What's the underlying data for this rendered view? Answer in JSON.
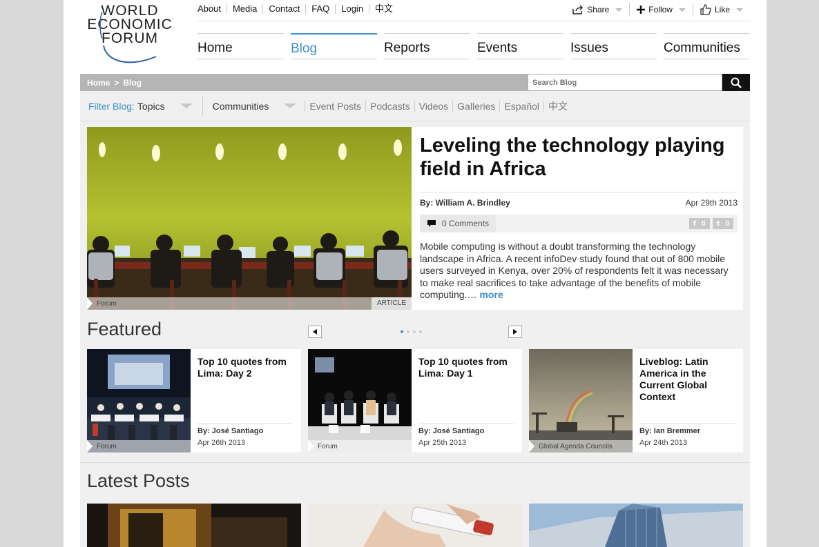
{
  "logo": {
    "lines": [
      "WORLD",
      "ECONOMIC",
      "FORUM"
    ]
  },
  "topnav": [
    "About",
    "Media",
    "Contact",
    "FAQ",
    "Login",
    "中文"
  ],
  "social": {
    "share": "Share",
    "follow": "Follow",
    "like": "Like"
  },
  "mainnav": [
    {
      "label": "Home",
      "active": false
    },
    {
      "label": "Blog",
      "active": true
    },
    {
      "label": "Reports",
      "active": false
    },
    {
      "label": "Events",
      "active": false
    },
    {
      "label": "Issues",
      "active": false
    },
    {
      "label": "Communities",
      "active": false
    }
  ],
  "breadcrumb": {
    "home": "Home",
    "sep": ">",
    "current": "Blog"
  },
  "search": {
    "placeholder": "Search Blog"
  },
  "filter": {
    "label": "Filter Blog:",
    "topics": "Topics",
    "communities": "Communities",
    "links": [
      "Event Posts",
      "Podcasts",
      "Videos",
      "Galleries",
      "Español",
      "中文"
    ]
  },
  "hero": {
    "title": "Leveling the technology playing field in Africa",
    "author": "By: William A. Brindley",
    "date": "Apr 29th 2013",
    "comments": "0 Comments",
    "fb_count": "0",
    "tw_count": "0",
    "body": "Mobile computing is without a doubt transforming the technology landscape in Africa. A recent infoDev study found that out of 800 mobile users surveyed in Kenya, over 20% of respondents felt it was necessary to make real sacrifices to take advantage of the benefits of mobile computing.…",
    "more": "more",
    "tag": "Forum",
    "type": "ARTICLE"
  },
  "featured": {
    "heading": "Featured",
    "items": [
      {
        "title": "Top 10 quotes from Lima: Day 2",
        "author": "By: José Santiago",
        "date": "Apr 26th 2013",
        "tag": "Forum"
      },
      {
        "title": "Top 10 quotes from Lima: Day 1",
        "author": "By: José Santiago",
        "date": "Apr 25th 2013",
        "tag": "Forum"
      },
      {
        "title": "Liveblog: Latin America in the Current Global Context",
        "author": "By: Ian Bremmer",
        "date": "Apr 24th 2013",
        "tag": "Global Agenda Councils"
      }
    ]
  },
  "latest": {
    "heading": "Latest Posts"
  },
  "colors": {
    "accent": "#3a8fc8",
    "wall": "#a9b82a"
  }
}
